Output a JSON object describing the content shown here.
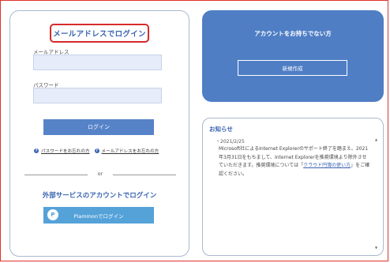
{
  "login": {
    "title": "メールアドレスでログイン",
    "email_label": "メールアドレス",
    "email_value": "",
    "password_label": "パスワード",
    "password_value": "",
    "login_button": "ログイン",
    "forgot_password": "パスワードをお忘れの方",
    "forgot_email": "メールアドレスをお忘れの方",
    "or_text": "or",
    "external_title": "外部サービスのアカウントでログイン",
    "plammon_button": "Plammonでログイン",
    "plammon_icon_letter": "P"
  },
  "account": {
    "title": "アカウントをお持ちでない方",
    "register_button": "新規作成"
  },
  "notices": {
    "title": "お知らせ",
    "items": [
      {
        "date": "2021/2/25",
        "text_before_link": "Microsoft社によるInternet Explorerのサポート終了を踏まえ、2021年3月31日をもちまして、Internet Explorerを推奨環境より除外させていただきます。推奨環境については「",
        "link_text": "クラウド円簿の使い方",
        "text_after_link": "」をご確認ください。"
      }
    ],
    "scroll_up": "▲",
    "scroll_down": "▼"
  },
  "colors": {
    "accent": "#3b64b2",
    "button_blue": "#5683c8",
    "plammon_blue": "#55a2d9",
    "card_blue": "#4f7ec5",
    "highlight_red": "#d52b2b"
  }
}
